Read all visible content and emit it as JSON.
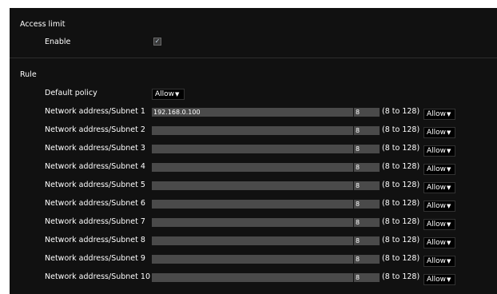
{
  "access_limit": {
    "title": "Access limit",
    "enable_label": "Enable",
    "enable_checked": true
  },
  "rule": {
    "title": "Rule",
    "default_policy_label": "Default policy",
    "default_policy_value": "Allow",
    "range_text": "(8 to 128)",
    "rows": [
      {
        "label": "Network address/Subnet 1",
        "address": "192.168.0.100",
        "subnet": "8",
        "policy": "Allow"
      },
      {
        "label": "Network address/Subnet 2",
        "address": "",
        "subnet": "8",
        "policy": "Allow"
      },
      {
        "label": "Network address/Subnet 3",
        "address": "",
        "subnet": "8",
        "policy": "Allow"
      },
      {
        "label": "Network address/Subnet 4",
        "address": "",
        "subnet": "8",
        "policy": "Allow"
      },
      {
        "label": "Network address/Subnet 5",
        "address": "",
        "subnet": "8",
        "policy": "Allow"
      },
      {
        "label": "Network address/Subnet 6",
        "address": "",
        "subnet": "8",
        "policy": "Allow"
      },
      {
        "label": "Network address/Subnet 7",
        "address": "",
        "subnet": "8",
        "policy": "Allow"
      },
      {
        "label": "Network address/Subnet 8",
        "address": "",
        "subnet": "8",
        "policy": "Allow"
      },
      {
        "label": "Network address/Subnet 9",
        "address": "",
        "subnet": "8",
        "policy": "Allow"
      },
      {
        "label": "Network address/Subnet 10",
        "address": "",
        "subnet": "8",
        "policy": "Allow"
      }
    ]
  },
  "colors": {
    "panel_bg": "#111111",
    "field_bg": "#4a4a4a",
    "text": "#ffffff"
  },
  "icons": {
    "dropdown": "triangle-down-icon",
    "checkbox": "checkmark-icon"
  }
}
